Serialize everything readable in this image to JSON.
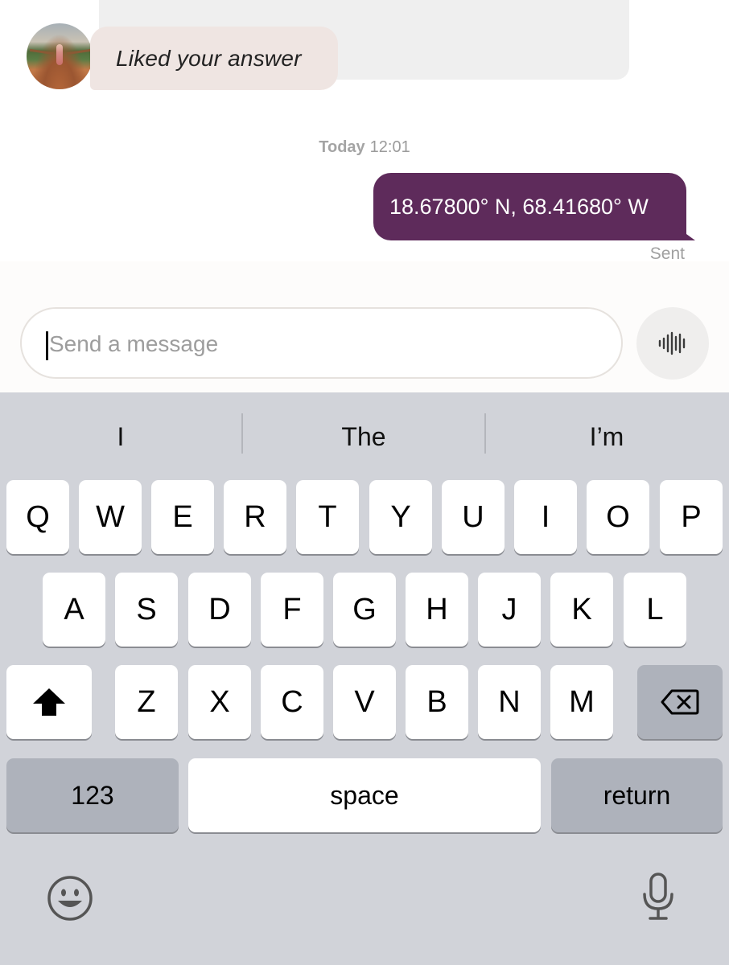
{
  "thread": {
    "liked_message": "Liked your answer",
    "timestamp_day": "Today",
    "timestamp_time": "12:01",
    "sent_message": "18.67800° N, 68.41680° W",
    "sent_status": "Sent"
  },
  "composer": {
    "placeholder": "Send a message",
    "voice_icon": "waveform-icon"
  },
  "keyboard": {
    "suggestions": [
      "I",
      "The",
      "I’m"
    ],
    "row1": [
      "Q",
      "W",
      "E",
      "R",
      "T",
      "Y",
      "U",
      "I",
      "O",
      "P"
    ],
    "row2": [
      "A",
      "S",
      "D",
      "F",
      "G",
      "H",
      "J",
      "K",
      "L"
    ],
    "row3": [
      "Z",
      "X",
      "C",
      "V",
      "B",
      "N",
      "M"
    ],
    "shift_icon": "shift-icon",
    "backspace_icon": "backspace-icon",
    "numbers_label": "123",
    "space_label": "space",
    "return_label": "return",
    "emoji_icon": "emoji-icon",
    "dictation_icon": "microphone-icon"
  },
  "colors": {
    "sent_bubble": "#5e2b5b",
    "liked_bubble": "#efe5e2",
    "keyboard_bg": "#d1d3d9"
  }
}
